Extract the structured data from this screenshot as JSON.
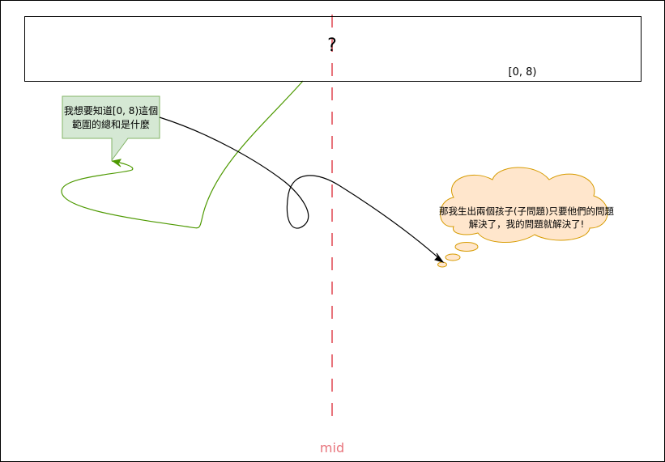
{
  "diagram": {
    "range_box": {
      "question": "?",
      "range_label": "[0, 8)"
    },
    "mid_line": {
      "label": "mid",
      "color": "#e8747c"
    },
    "callout": {
      "text": "我想要知道[0, 8)這個範圍的總和是什麼",
      "fill": "#d5e8d4",
      "stroke": "#82b366"
    },
    "thought_cloud": {
      "text": "那我生出兩個孩子(子問題)只要他們的問題解決了，我的問題就解決了!",
      "fill": "#ffe6cc",
      "stroke": "#d79b00"
    },
    "arrows": {
      "green_arrow_color": "#4d9900",
      "black_arrow_color": "#000000"
    }
  }
}
